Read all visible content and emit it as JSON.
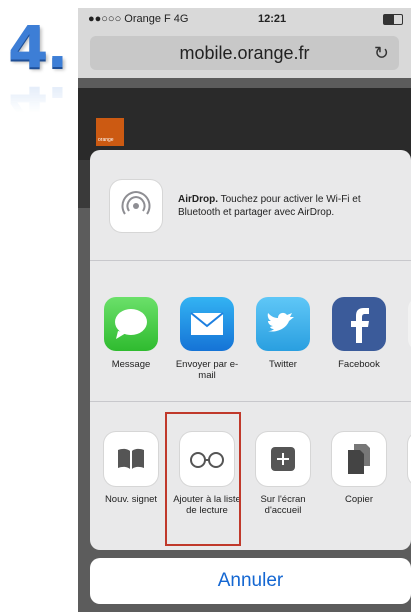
{
  "step": {
    "number": "4."
  },
  "status_bar": {
    "carrier": "●●○○○ Orange F  4G",
    "time": "12:21"
  },
  "url_bar": {
    "url": "mobile.orange.fr",
    "reload_icon": "reload-icon"
  },
  "web_page": {
    "logo_text": "orange"
  },
  "airdrop": {
    "title": "AirDrop.",
    "description": " Touchez pour activer le Wi-Fi et Bluetooth et partager avec AirDrop."
  },
  "apps": [
    {
      "label": "Message",
      "icon": "message-icon"
    },
    {
      "label": "Envoyer par e-mail",
      "icon": "mail-icon"
    },
    {
      "label": "Twitter",
      "icon": "twitter-icon"
    },
    {
      "label": "Facebook",
      "icon": "facebook-icon"
    }
  ],
  "actions": [
    {
      "label": "Nouv. signet",
      "icon": "bookmark-icon"
    },
    {
      "label": "Ajouter à la liste de lecture",
      "icon": "reading-list-icon"
    },
    {
      "label": "Sur l'écran d'accueil",
      "icon": "add-to-home-icon"
    },
    {
      "label": "Copier",
      "icon": "copy-icon"
    }
  ],
  "cancel": {
    "label": "Annuler"
  },
  "colors": {
    "accent": "#1467d2",
    "highlight": "#c0392b",
    "step": "#3d7ed6"
  }
}
